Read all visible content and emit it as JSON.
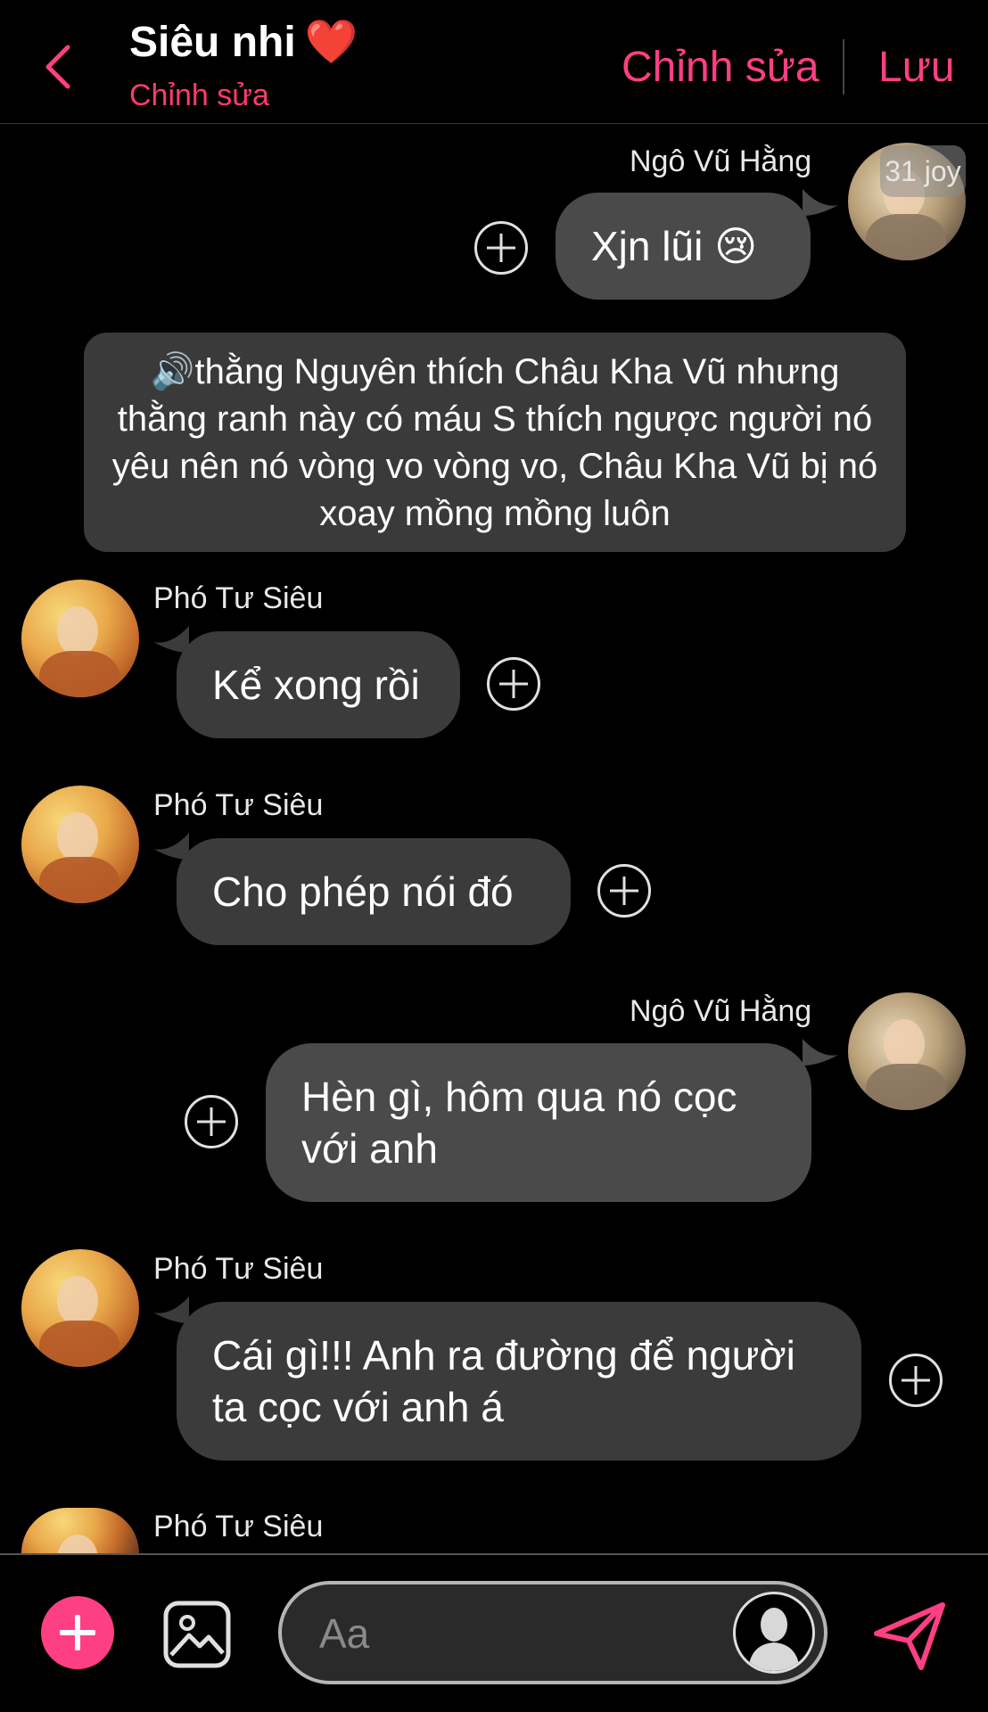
{
  "header": {
    "title": "Siêu nhi",
    "title_emoji": "❤️",
    "subtitle": "Chỉnh sửa",
    "edit_label": "Chỉnh sửa",
    "save_label": "Lưu"
  },
  "messages": [
    {
      "sender": "Ngô Vũ Hằng",
      "text": "Xjn lũi 😢",
      "side": "right",
      "avatar_badge": "31 joy"
    },
    {
      "type": "narration",
      "icon": "🔊",
      "text": "thằng Nguyên thích Châu Kha Vũ nhưng thằng ranh này có máu S thích ngược người nó yêu nên nó vòng vo vòng vo, Châu Kha Vũ bị nó xoay mồng mồng luôn"
    },
    {
      "sender": "Phó Tư Siêu",
      "text": "Kể xong rồi",
      "side": "left"
    },
    {
      "sender": "Phó Tư Siêu",
      "text": "Cho phép nói đó",
      "side": "left"
    },
    {
      "sender": "Ngô Vũ Hằng",
      "text_line1": "Hèn gì, hôm qua nó cọc",
      "text_line2": "với anh",
      "side": "right"
    },
    {
      "sender": "Phó Tư Siêu",
      "text_line1": "Cái gì!!! Anh ra đường để người",
      "text_line2": "ta cọc với anh á",
      "side": "left"
    },
    {
      "sender": "Phó Tư Siêu",
      "side": "left"
    }
  ],
  "composer": {
    "placeholder": "Aa"
  },
  "colors": {
    "accent": "#ff3f83",
    "bubble": "#4a4a4a",
    "heart": "#ff2b3d"
  },
  "icons": [
    "back-chevron-icon",
    "plus-circle-icon",
    "add-icon",
    "image-icon",
    "character-avatar-icon",
    "send-icon",
    "speaker-icon"
  ]
}
